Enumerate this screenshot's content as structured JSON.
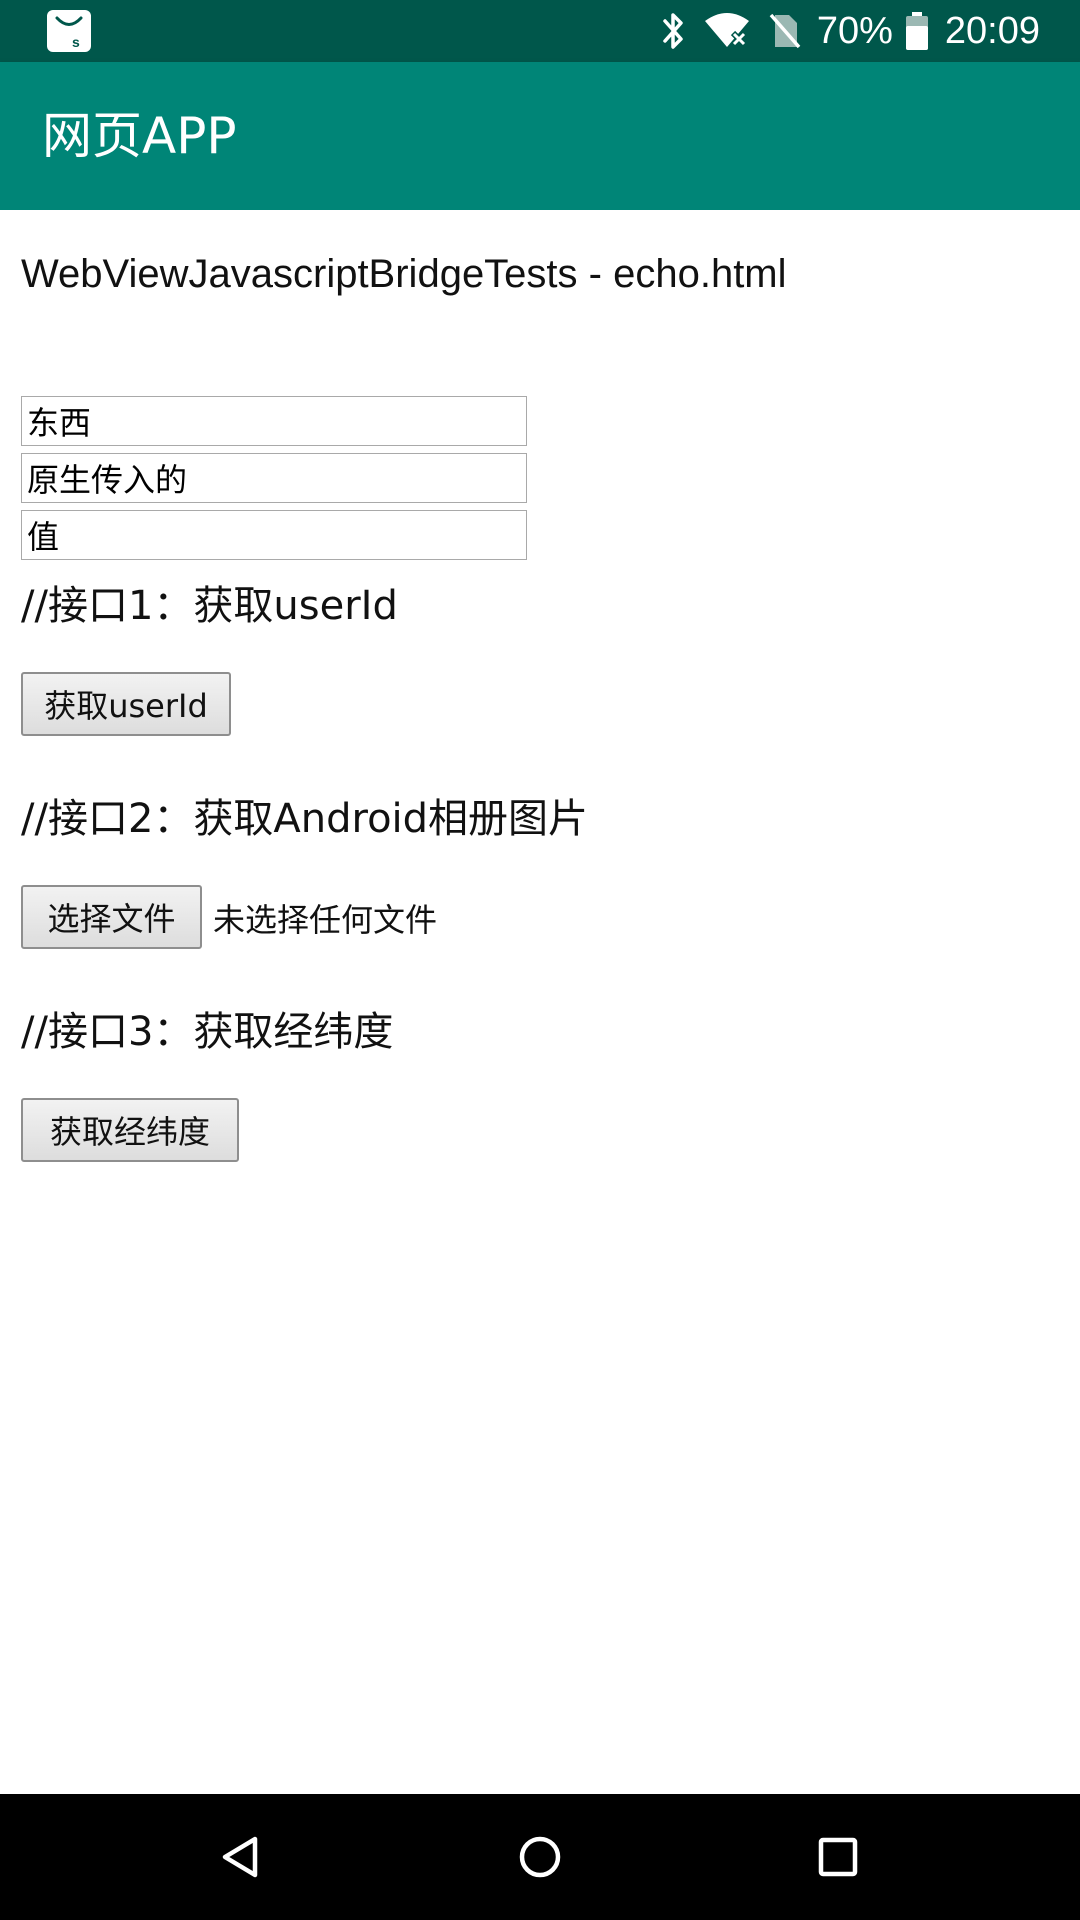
{
  "status_bar": {
    "battery_percent": "70%",
    "time": "20:09",
    "app_icon": "shopping-bag-s-icon",
    "icons": [
      "bluetooth-icon",
      "wifi-off-icon",
      "no-sim-icon",
      "battery-icon"
    ],
    "background_color": "#00574b"
  },
  "app_bar": {
    "title": "网页APP",
    "background_color": "#008577"
  },
  "web": {
    "heading": "WebViewJavascriptBridgeTests - echo.html",
    "inputs": [
      {
        "value": "东西"
      },
      {
        "value": "原生传入的"
      },
      {
        "value": "值"
      }
    ],
    "sections": [
      {
        "title": "//接口1：获取userId",
        "button_label": "获取userId"
      },
      {
        "title": "//接口2：获取Android相册图片",
        "button_label": "选择文件",
        "file_status": "未选择任何文件"
      },
      {
        "title": "//接口3：获取经纬度",
        "button_label": "获取经纬度"
      }
    ]
  },
  "nav_bar": {
    "icons": [
      "back-icon",
      "home-icon",
      "recents-icon"
    ]
  }
}
